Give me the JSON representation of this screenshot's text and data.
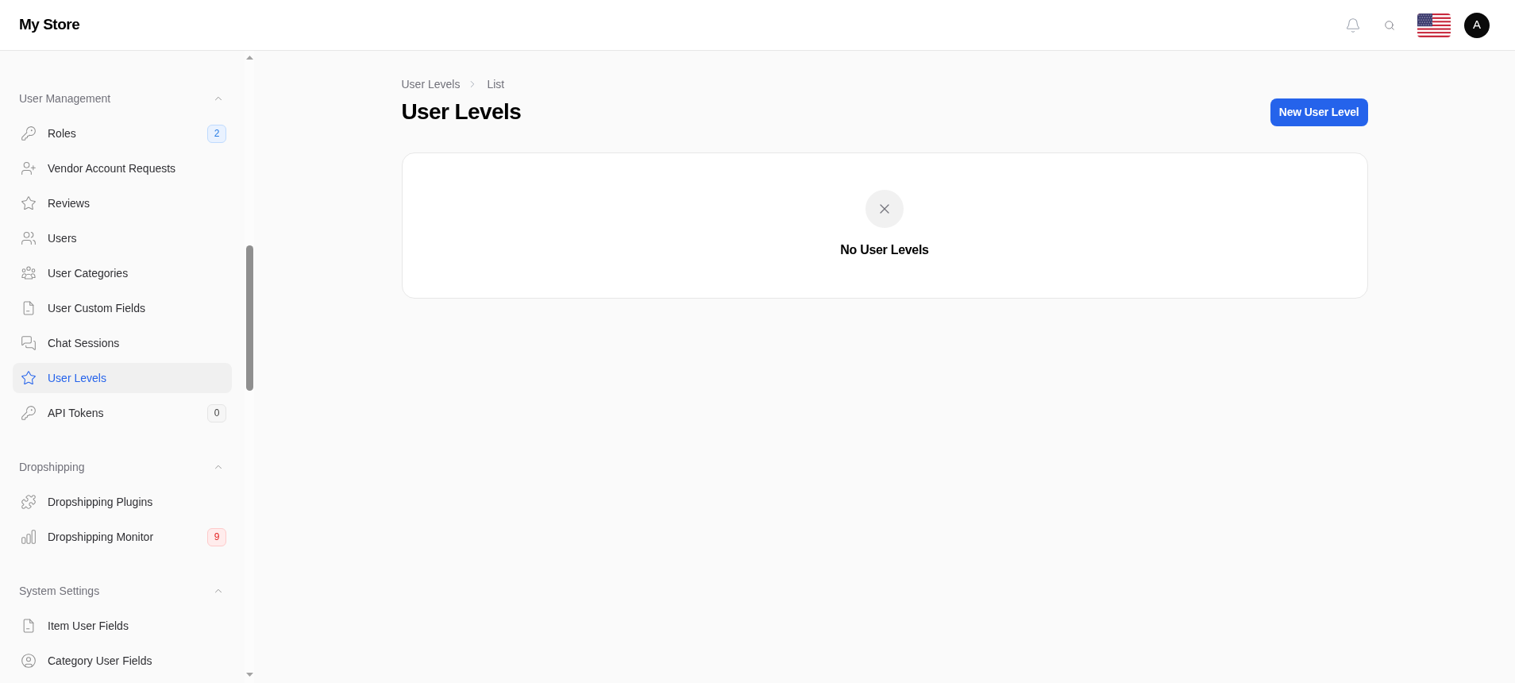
{
  "header": {
    "title": "My Store",
    "avatar": "A"
  },
  "sidebar": {
    "sections": [
      {
        "title": "User Management",
        "expanded": true,
        "items": [
          {
            "label": "Roles",
            "selected": false,
            "badge": {
              "text": "2",
              "color": "#bfdbfe"
            }
          },
          {
            "label": "Vendor Account Requests",
            "selected": false
          },
          {
            "label": "Reviews",
            "selected": false
          },
          {
            "label": "Users",
            "selected": false
          },
          {
            "label": "User Categories",
            "selected": false
          },
          {
            "label": "User Custom Fields",
            "selected": false
          },
          {
            "label": "Chat Sessions",
            "selected": false
          },
          {
            "label": "User Levels",
            "selected": true
          },
          {
            "label": "API Tokens",
            "selected": false,
            "badge": {
              "text": "0",
              "color": "#e5e5e5"
            }
          }
        ]
      },
      {
        "title": "Dropshipping",
        "expanded": true,
        "items": [
          {
            "label": "Dropshipping Plugins",
            "selected": false
          },
          {
            "label": "Dropshipping Monitor",
            "selected": false,
            "badge": {
              "text": "9",
              "color": "#fecaca"
            }
          }
        ]
      },
      {
        "title": "System Settings",
        "expanded": true,
        "items": [
          {
            "label": "Item User Fields",
            "selected": false
          },
          {
            "label": "Category User Fields",
            "selected": false
          }
        ]
      }
    ]
  },
  "breadcrumb": [
    "User Levels",
    "List"
  ],
  "page": {
    "title": "User Levels",
    "primary_button": "New User Level"
  },
  "empty_state": {
    "message": "No User Levels"
  }
}
